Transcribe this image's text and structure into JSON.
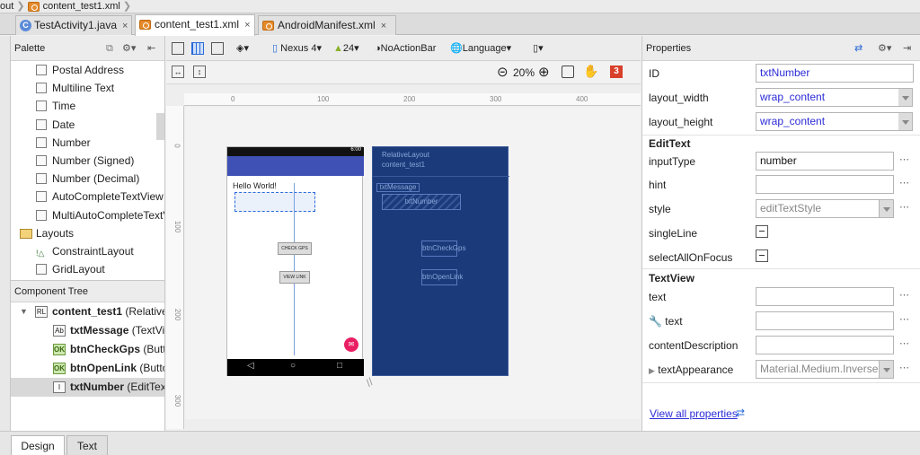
{
  "breadcrumb": {
    "items": [
      "out",
      "content_test1.xml"
    ]
  },
  "tabs": [
    {
      "label": "TestActivity1.java",
      "close": "×"
    },
    {
      "label": "content_test1.xml",
      "close": "×"
    },
    {
      "label": "AndroidManifest.xml",
      "close": "×"
    }
  ],
  "palette": {
    "title": "Palette",
    "items": [
      {
        "label": "Postal Address"
      },
      {
        "label": "Multiline Text"
      },
      {
        "label": "Time"
      },
      {
        "label": "Date"
      },
      {
        "label": "Number"
      },
      {
        "label": "Number (Signed)"
      },
      {
        "label": "Number (Decimal)"
      },
      {
        "label": "AutoCompleteTextView"
      },
      {
        "label": "MultiAutoCompleteTextView"
      },
      {
        "label": "Layouts"
      },
      {
        "label": "ConstraintLayout"
      },
      {
        "label": "GridLayout"
      }
    ]
  },
  "component_tree": {
    "title": "Component Tree",
    "items": [
      {
        "name": "content_test1",
        "type": " (RelativeLayout)",
        "icon": "RL"
      },
      {
        "name": "txtMessage",
        "type": " (TextView)",
        "icon": "Ab"
      },
      {
        "name": "btnCheckGps",
        "type": " (Button)",
        "icon": "OK"
      },
      {
        "name": "btnOpenLink",
        "type": " (Button)",
        "icon": "OK"
      },
      {
        "name": "txtNumber",
        "type": " (EditText)",
        "icon": "I"
      }
    ]
  },
  "toolbar": {
    "device": "Nexus 4",
    "api": "24",
    "theme": "NoActionBar",
    "language": "Language",
    "zoom": "20%",
    "error_count": "3"
  },
  "canvas": {
    "ruler_top": [
      "0",
      "100",
      "200",
      "300",
      "400"
    ],
    "ruler_left": [
      "0",
      "100",
      "200",
      "300"
    ],
    "phone": {
      "status_time": "6:00",
      "hello": "Hello World!",
      "btn_check": "CHECK GPS",
      "btn_link": "VIEW LINK"
    },
    "blueprint": {
      "layout_type": "RelativeLayout",
      "layout_name": "content_test1",
      "txt_message": "txtMessage",
      "txt_number": "txtNumber",
      "btn_check": "btnCheckGps",
      "btn_link": "btnOpenLink"
    }
  },
  "properties": {
    "title": "Properties",
    "id_label": "ID",
    "id_value": "txtNumber",
    "lw_label": "layout_width",
    "lw_value": "wrap_content",
    "lh_label": "layout_height",
    "lh_value": "wrap_content",
    "section_edittext": "EditText",
    "input_type_label": "inputType",
    "input_type_value": "number",
    "hint_label": "hint",
    "style_label": "style",
    "style_value": "editTextStyle",
    "single_line_label": "singleLine",
    "select_all_label": "selectAllOnFocus",
    "section_textview": "TextView",
    "text_label": "text",
    "tools_text_label": "text",
    "content_desc_label": "contentDescription",
    "text_appearance_label": "textAppearance",
    "text_appearance_value": "Material.Medium.Inverse",
    "view_all": "View all properties"
  },
  "bottom_tabs": [
    "Design",
    "Text"
  ],
  "colors": {
    "accent": "#3f51b5",
    "blueprint": "#1a3a7a",
    "link": "#2b2bd6"
  }
}
